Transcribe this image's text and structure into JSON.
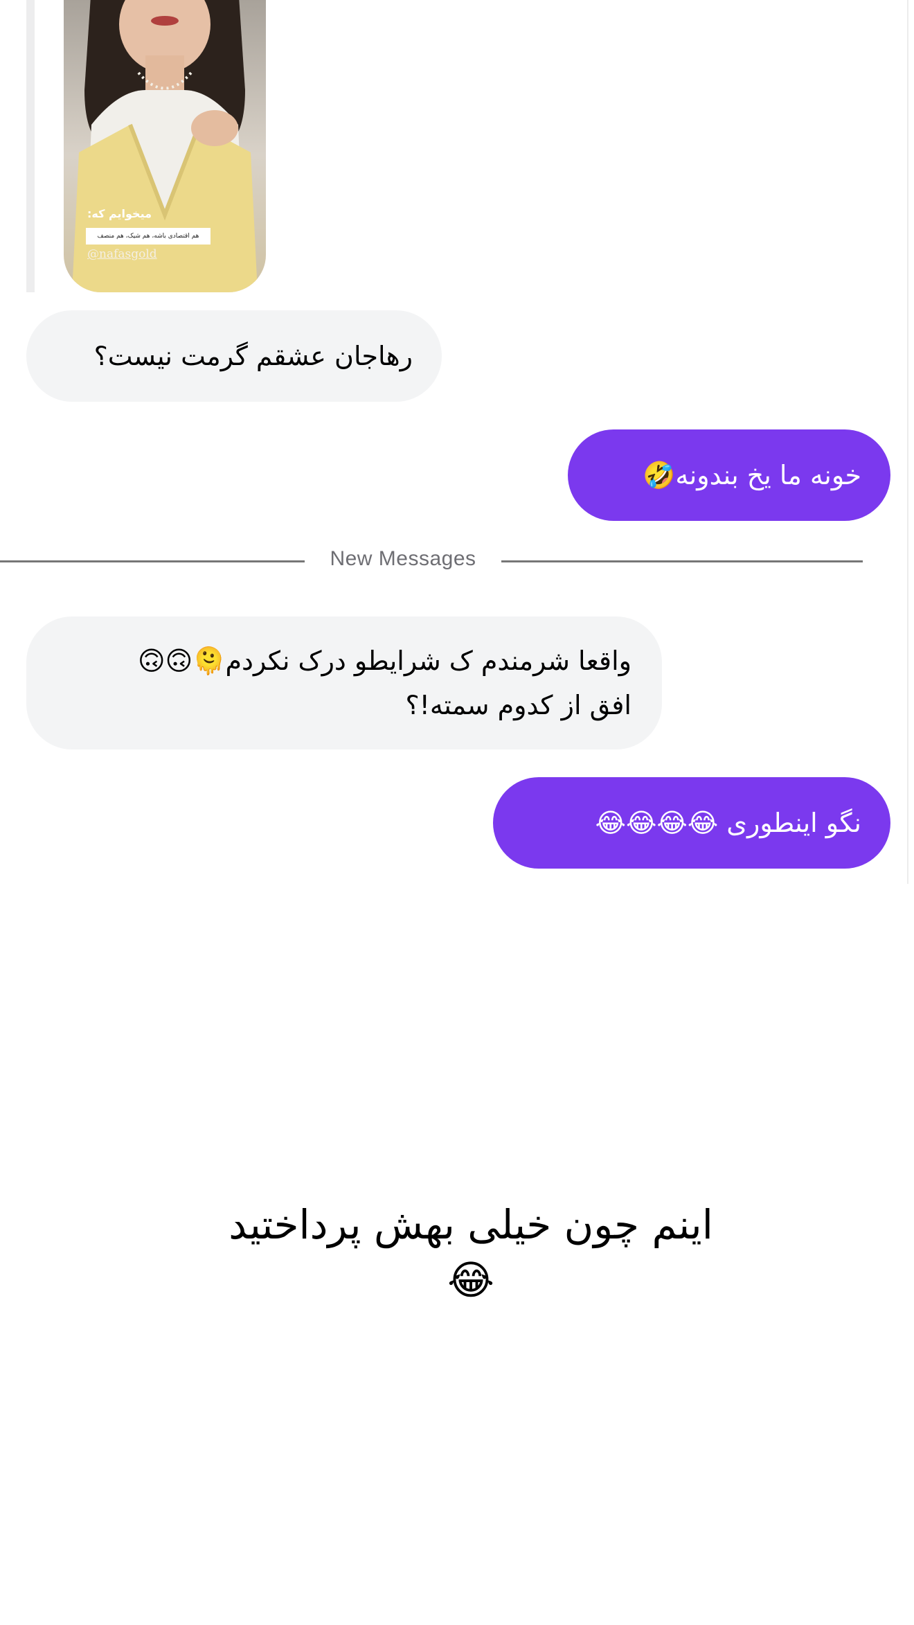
{
  "story_reply": {
    "image_name": "story-image",
    "overlay_heading": "میخوایم که:",
    "overlay_box_text": "هم اقتصادی باشه، هم شیک، هم منصف",
    "overlay_handle": "@nafasgold"
  },
  "messages": [
    {
      "direction": "incoming",
      "lines": [
        "رهاجان عشقم گرمت نیست؟"
      ]
    },
    {
      "direction": "outgoing",
      "lines": [
        "خونه ما یخ بندونه🤣"
      ]
    },
    {
      "direction": "incoming",
      "lines": [
        "واقعا شرمندم ک شرایطو درک نکردم🫠🙃🙃",
        "افق از کدوم سمته!؟"
      ]
    },
    {
      "direction": "outgoing",
      "lines": [
        "نگو اینطوری 😂😂😂😂"
      ]
    }
  ],
  "divider": {
    "label": "New Messages"
  },
  "caption": {
    "text": "اینم چون خیلی بهش پرداختید😂"
  },
  "colors": {
    "outgoing_bubble": "#7b39ee",
    "incoming_bubble": "#f3f4f5",
    "divider_text": "#6e6e73"
  }
}
